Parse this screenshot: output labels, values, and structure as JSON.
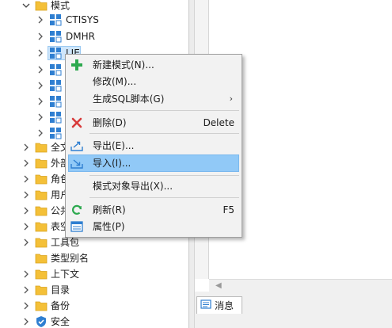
{
  "tree": {
    "root": {
      "label": "模式",
      "expanded": true
    },
    "schemas": [
      {
        "label": "CTISYS"
      },
      {
        "label": "DMHR"
      },
      {
        "label": "LIE"
      }
    ],
    "partial_nodes": [
      {
        "label": "全文"
      },
      {
        "label": "外部"
      },
      {
        "label": "角色"
      },
      {
        "label": "用户"
      },
      {
        "label": "公共"
      },
      {
        "label": "表空"
      }
    ],
    "folders": [
      {
        "label": "工具包"
      },
      {
        "label": "类型别名"
      },
      {
        "label": "上下文"
      },
      {
        "label": "目录"
      },
      {
        "label": "备份"
      },
      {
        "label": "安全"
      }
    ]
  },
  "context_menu": {
    "items": [
      {
        "label": "新建模式(N)...",
        "icon": "plus-icon",
        "shortcut": ""
      },
      {
        "label": "修改(M)...",
        "icon": "",
        "shortcut": ""
      },
      {
        "label": "生成SQL脚本(G)",
        "icon": "",
        "shortcut": "",
        "submenu": true
      },
      {
        "label": "删除(D)",
        "icon": "delete-x-icon",
        "shortcut": "Delete"
      },
      {
        "label": "导出(E)...",
        "icon": "export-icon",
        "shortcut": ""
      },
      {
        "label": "导入(I)...",
        "icon": "import-icon",
        "shortcut": "",
        "highlighted": true
      },
      {
        "label": "模式对象导出(X)...",
        "icon": "",
        "shortcut": ""
      },
      {
        "label": "刷新(R)",
        "icon": "refresh-icon",
        "shortcut": "F5"
      },
      {
        "label": "属性(P)",
        "icon": "properties-icon",
        "shortcut": ""
      }
    ],
    "submenu_arrow": "›"
  },
  "bottom_panel": {
    "tab_label": "消息"
  },
  "colors": {
    "highlight": "#91c9f7",
    "folder": "#f4c038",
    "schema_icon": "#2f7fd1",
    "plus": "#2da94f",
    "delete": "#d83b3b"
  }
}
